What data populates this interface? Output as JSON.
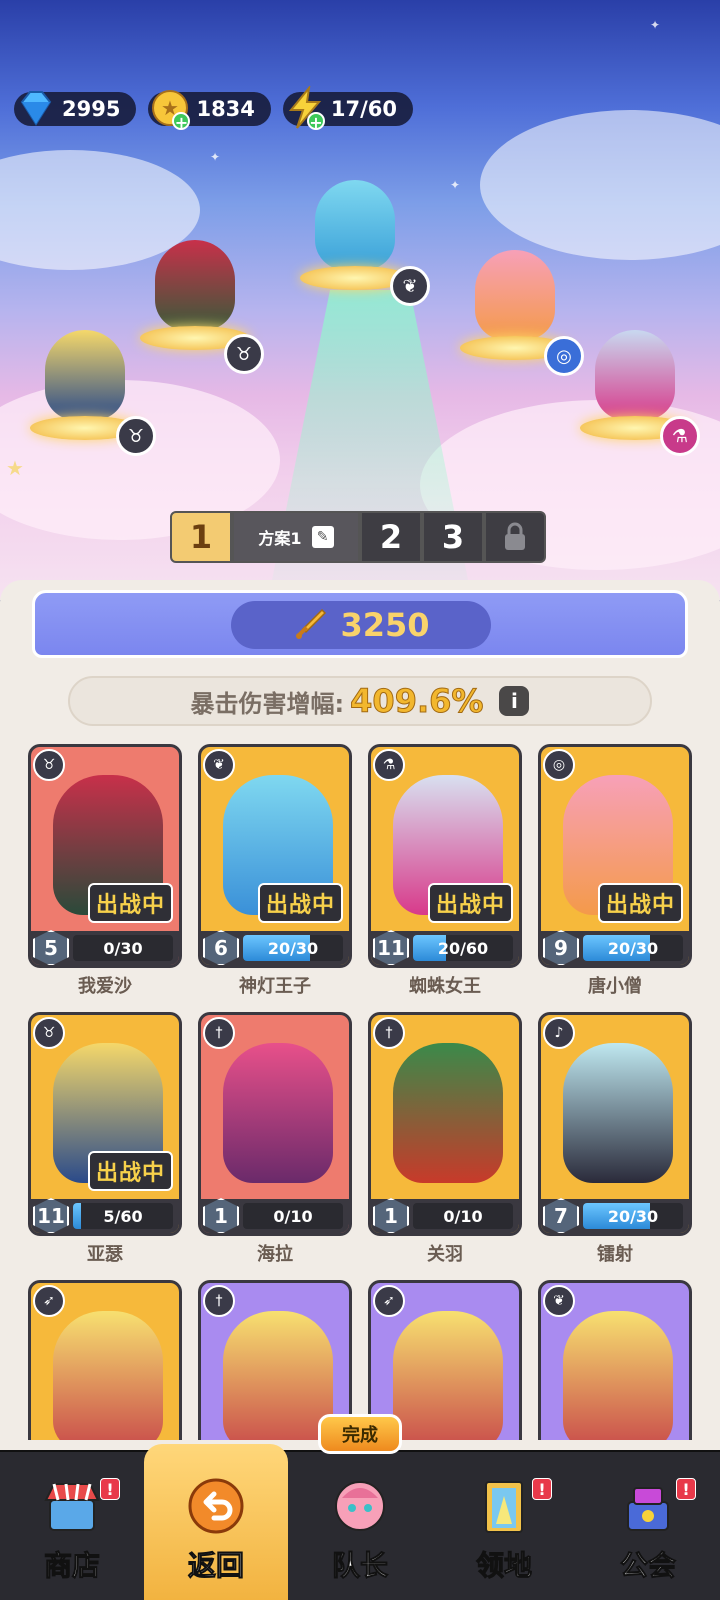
{
  "currencies": [
    {
      "name": "gem",
      "value": "2995",
      "icon": "gem-icon"
    },
    {
      "name": "gold",
      "value": "1834",
      "icon": "gold-coin-icon"
    },
    {
      "name": "energy",
      "value": "17/60",
      "icon": "energy-bolt-icon"
    }
  ],
  "lineup_tabs": {
    "tab1": "1",
    "plan_label": "方案1",
    "tab2": "2",
    "tab3": "3"
  },
  "power": "3250",
  "crit": {
    "label": "暴击伤害增幅:",
    "value": "409.6%",
    "info": "i"
  },
  "in_battle_label": "出战中",
  "heroes": [
    {
      "name": "我爱沙",
      "level": "5",
      "progress": "0/30",
      "fraction": 0.0,
      "in_battle": true,
      "role": "bull-icon",
      "color": "red"
    },
    {
      "name": "神灯王子",
      "level": "6",
      "progress": "20/30",
      "fraction": 0.667,
      "in_battle": true,
      "role": "wings-icon",
      "color": "yellow"
    },
    {
      "name": "蜘蛛女王",
      "level": "11",
      "progress": "20/60",
      "fraction": 0.333,
      "in_battle": true,
      "role": "potion-icon",
      "color": "yellow"
    },
    {
      "name": "唐小僧",
      "level": "9",
      "progress": "20/30",
      "fraction": 0.667,
      "in_battle": true,
      "role": "spiral-icon",
      "color": "yellow"
    },
    {
      "name": "亚瑟",
      "level": "11",
      "progress": "5/60",
      "fraction": 0.083,
      "in_battle": true,
      "role": "bull-icon",
      "color": "yellow"
    },
    {
      "name": "海拉",
      "level": "1",
      "progress": "0/10",
      "fraction": 0.0,
      "in_battle": false,
      "role": "sword-icon",
      "color": "red"
    },
    {
      "name": "关羽",
      "level": "1",
      "progress": "0/10",
      "fraction": 0.0,
      "in_battle": false,
      "role": "sword-icon",
      "color": "yellow"
    },
    {
      "name": "镭射",
      "level": "7",
      "progress": "20/30",
      "fraction": 0.667,
      "in_battle": false,
      "role": "staff-icon",
      "color": "yellow"
    }
  ],
  "partial_heroes": [
    {
      "role": "bow-icon",
      "color": "yellow"
    },
    {
      "role": "sword-icon",
      "color": "purple"
    },
    {
      "role": "bow-icon",
      "color": "purple"
    },
    {
      "role": "wings-icon",
      "color": "purple"
    }
  ],
  "nav": {
    "shop": "商店",
    "back": "返回",
    "captain": "队长",
    "territory": "领地",
    "guild": "公会",
    "done_badge": "完成",
    "alert": "!"
  },
  "colors": {
    "card_red": "#ee7b6e",
    "card_yellow": "#f6b93b",
    "card_purple": "#a98bf0",
    "power_gold": "#f9d36b",
    "progress_blue": "#2c8ad8"
  }
}
